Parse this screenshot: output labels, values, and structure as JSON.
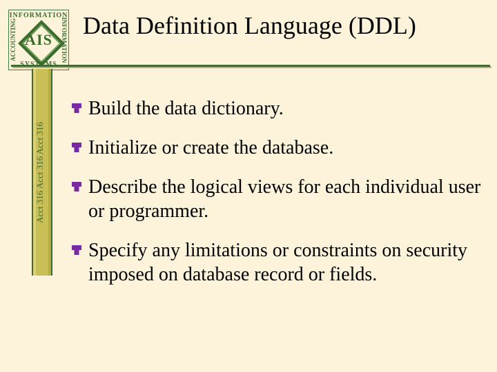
{
  "logo": {
    "center": "AIS",
    "top": "INFORMATION",
    "bottom": "SYSTEMS",
    "left": "ACCOUNTING",
    "right": "INFORMATION"
  },
  "title": "Data Definition Language (DDL)",
  "spine": "Acct 316   Acct 316   Acct 316",
  "bullets": [
    "Build the data dictionary.",
    "Initialize or create the database.",
    "Describe the logical views for each individual user or programmer.",
    "Specify any limitations or constraints on security imposed on database record or fields."
  ],
  "colors": {
    "accent": "#3c6b2e",
    "bullet": "#7a2aa0"
  }
}
